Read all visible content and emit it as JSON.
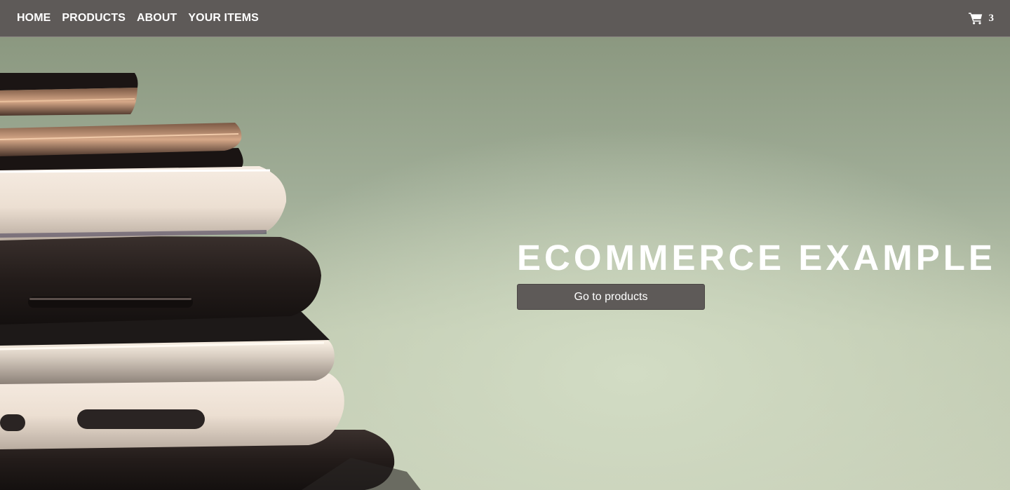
{
  "nav": {
    "links": [
      {
        "label": "HOME"
      },
      {
        "label": "PRODUCTS"
      },
      {
        "label": "ABOUT"
      },
      {
        "label": "YOUR ITEMS"
      }
    ],
    "cart": {
      "icon": "shopping-cart-icon",
      "count": "3"
    }
  },
  "hero": {
    "title": "ECOMMERCE EXAMPLE",
    "button_label": "Go to products",
    "image": "stacked-smartphones-photo"
  },
  "colors": {
    "navbar": "#5e5a58",
    "button": "#5e5a58",
    "text": "#ffffff",
    "hero_background": "#b5c2aa"
  }
}
